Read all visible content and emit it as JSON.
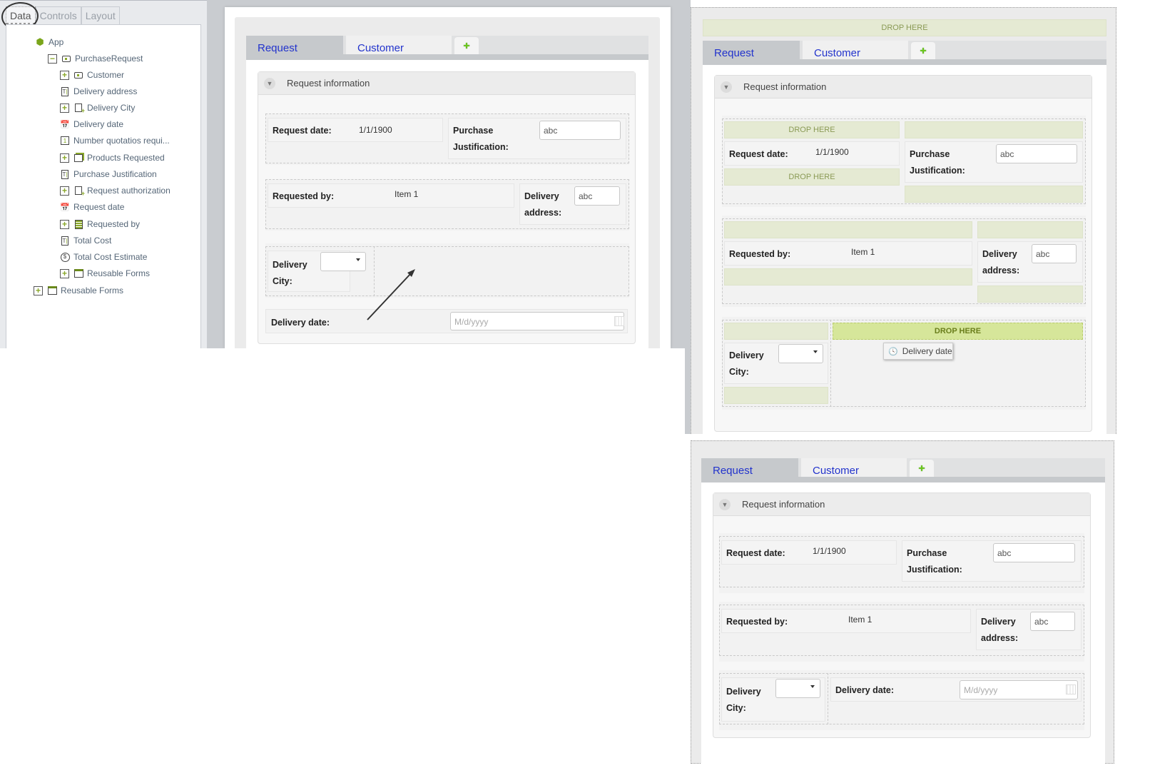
{
  "left_panel": {
    "tabs": [
      {
        "label": "Data",
        "active": true
      },
      {
        "label": "Controls",
        "active": false
      },
      {
        "label": "Layout",
        "active": false
      }
    ],
    "tree": [
      {
        "label": "App",
        "icon": "app-hexagon-icon",
        "level": 0,
        "expander": null
      },
      {
        "label": "PurchaseRequest",
        "icon": "entity-icon",
        "level": 1,
        "expander": "minus"
      },
      {
        "label": "Customer",
        "icon": "entity-icon",
        "level": 2,
        "expander": "plus"
      },
      {
        "label": "Delivery address",
        "icon": "text-field-icon",
        "level": 2,
        "expander": null
      },
      {
        "label": "Delivery City",
        "icon": "entity-reference-icon",
        "level": 2,
        "expander": "plus"
      },
      {
        "label": "Delivery date",
        "icon": "date-time-icon",
        "level": 2,
        "expander": null
      },
      {
        "label": "Number quotatios requi...",
        "icon": "number-icon",
        "level": 2,
        "expander": null
      },
      {
        "label": "Products Requested",
        "icon": "collection-icon",
        "level": 2,
        "expander": "plus"
      },
      {
        "label": "Purchase Justification",
        "icon": "text-field-icon",
        "level": 2,
        "expander": null
      },
      {
        "label": "Request authorization",
        "icon": "entity-reference-icon",
        "level": 2,
        "expander": "plus"
      },
      {
        "label": "Request date",
        "icon": "date-time-icon",
        "level": 2,
        "expander": null
      },
      {
        "label": "Requested by",
        "icon": "combo-icon",
        "level": 2,
        "expander": "plus"
      },
      {
        "label": "Total Cost",
        "icon": "text-field-icon",
        "level": 2,
        "expander": null
      },
      {
        "label": "Total Cost Estimate",
        "icon": "currency-icon",
        "level": 2,
        "expander": null
      },
      {
        "label": "Reusable Forms",
        "icon": "form-icon",
        "level": 2,
        "expander": "plus"
      },
      {
        "label": "Reusable Forms",
        "icon": "form-icon",
        "level": 0,
        "expander": "plus"
      }
    ]
  },
  "form": {
    "tabs": [
      "Request",
      "Customer"
    ],
    "add_tab": "+",
    "section_title": "Request information",
    "fields": {
      "request_date_label": "Request date:",
      "request_date_value": "1/1/1900",
      "purchase_justification_label_1": "Purchase",
      "purchase_justification_label_2": "Justification:",
      "purchase_justification_value": "abc",
      "requested_by_label": "Requested by:",
      "requested_by_value": "Item 1",
      "delivery_address_label_1": "Delivery",
      "delivery_address_label_2": "address:",
      "delivery_address_value": "abc",
      "delivery_city_label_1": "Delivery",
      "delivery_city_label_2": "City:",
      "delivery_date_label": "Delivery date:",
      "delivery_date_placeholder": "M/d/yyyy"
    }
  },
  "drag": {
    "drop_label": "DROP HERE",
    "chip_label": "Delivery date"
  },
  "colors": {
    "tab_link": "#2233cc",
    "drop_zone": "#e5ead3",
    "drop_zone_active": "#d6e69a",
    "accent_green": "#8aa82a"
  }
}
